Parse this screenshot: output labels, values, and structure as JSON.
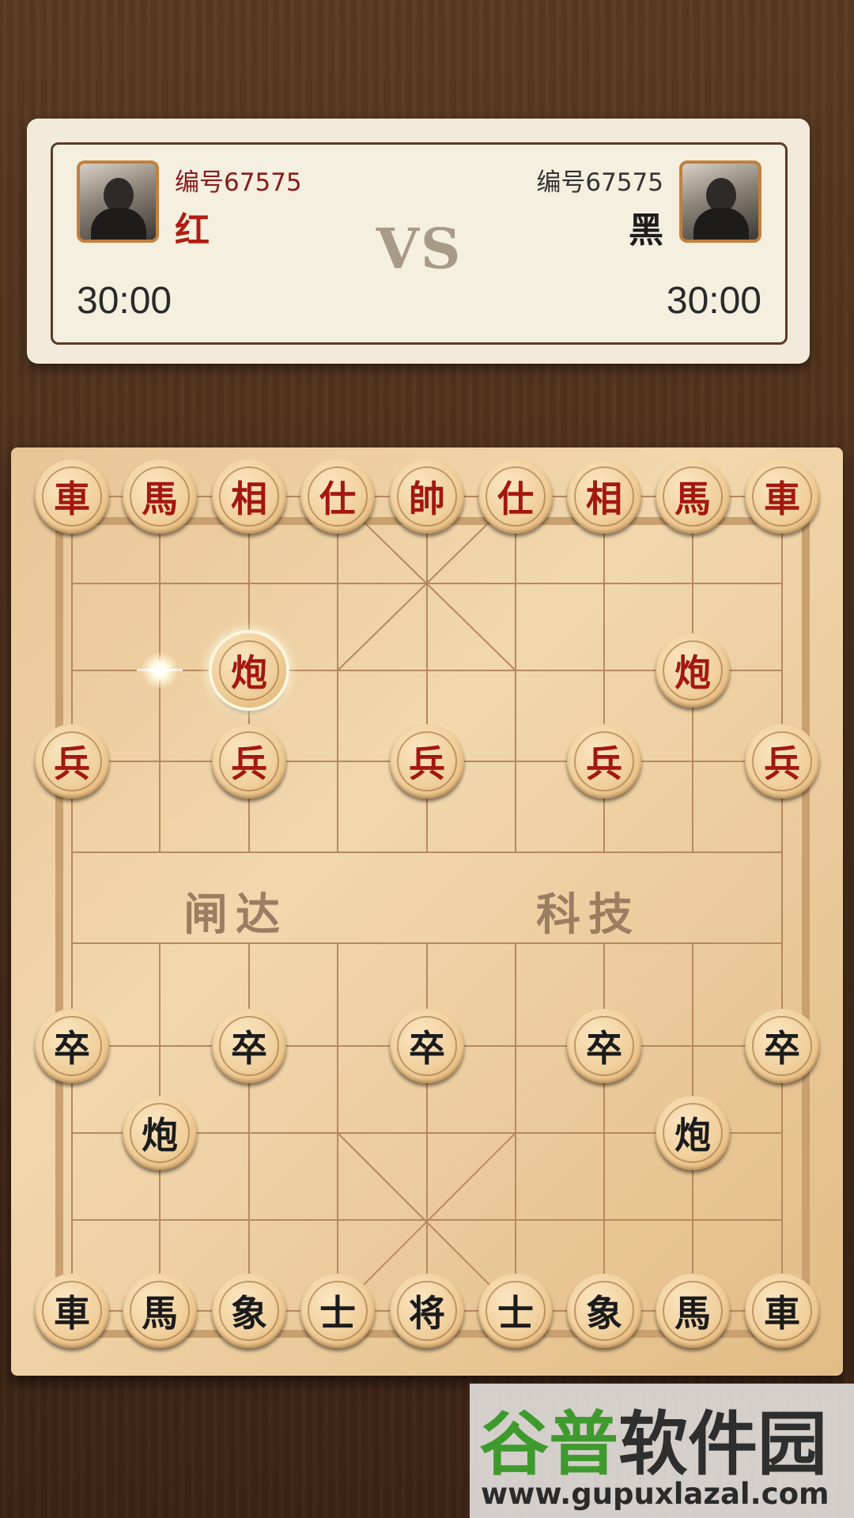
{
  "header": {
    "red_player": {
      "id_label": "编号67575",
      "side_label": "红",
      "timer": "30:00"
    },
    "black_player": {
      "id_label": "编号67575",
      "side_label": "黑",
      "timer": "30:00"
    },
    "vs_label": "VS"
  },
  "board": {
    "river_left": "闸达",
    "river_right": "科技",
    "colors": {
      "red": "#a3180f",
      "black": "#1b1b1b",
      "board": "#f0d2a4",
      "lines": "#b5895f"
    },
    "top_red_pieces": [
      "車",
      "馬",
      "相",
      "仕",
      "帥",
      "仕",
      "相",
      "馬",
      "車"
    ],
    "red_cannons": [
      "炮",
      "炮"
    ],
    "red_soldiers": [
      "兵",
      "兵",
      "兵",
      "兵",
      "兵"
    ],
    "black_soldiers": [
      "卒",
      "卒",
      "卒",
      "卒",
      "卒"
    ],
    "black_cannons": [
      "炮",
      "炮"
    ],
    "bottom_black_pieces": [
      "車",
      "馬",
      "象",
      "士",
      "将",
      "士",
      "象",
      "馬",
      "車"
    ],
    "selected_piece": "炮",
    "move_hint": "target-dot"
  },
  "watermark": {
    "title_green": "谷普",
    "title_dark": "软件园",
    "url": "www.gupuxlazal.com"
  }
}
